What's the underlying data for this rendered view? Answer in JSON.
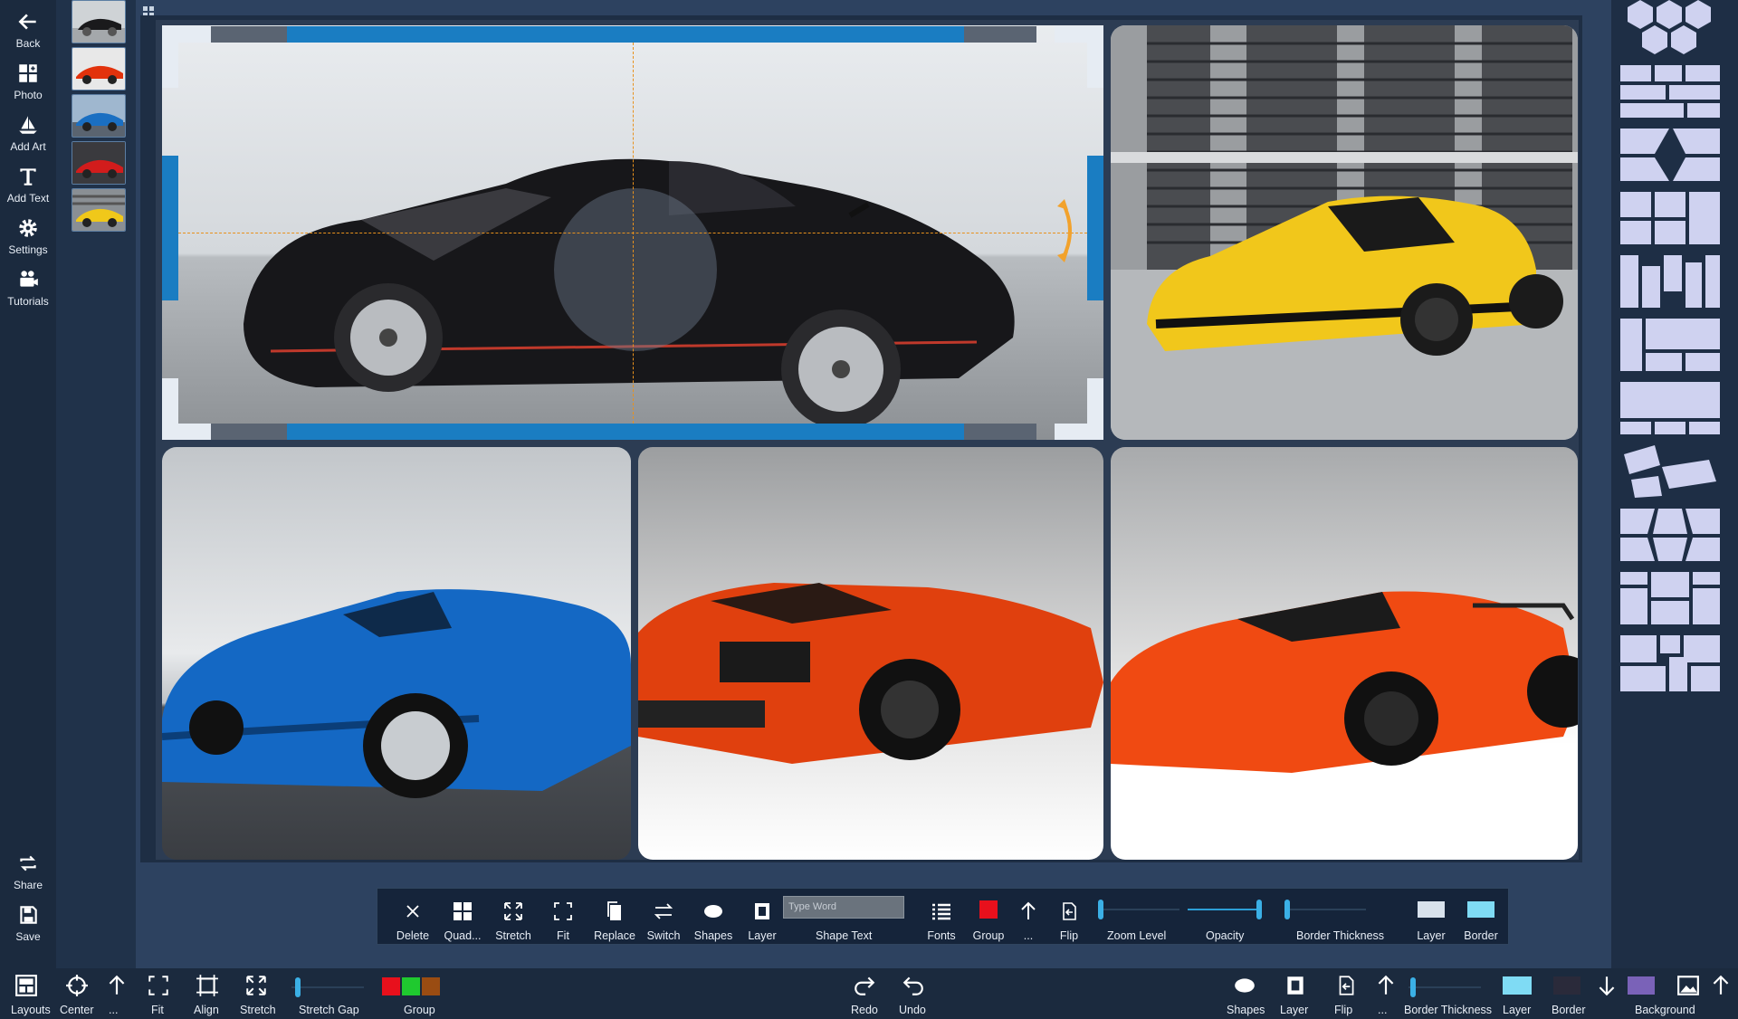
{
  "left_toolbar": {
    "items": [
      {
        "label": "Back",
        "icon": "arrow-left-icon"
      },
      {
        "label": "Photo",
        "icon": "photo-grid-icon"
      },
      {
        "label": "Add Art",
        "icon": "sailboat-icon"
      },
      {
        "label": "Add Text",
        "icon": "text-t-icon"
      },
      {
        "label": "Settings",
        "icon": "gear-icon"
      },
      {
        "label": "Tutorials",
        "icon": "camera-icon"
      }
    ],
    "bottom_items": [
      {
        "label": "Share",
        "icon": "share-icon"
      },
      {
        "label": "Save",
        "icon": "save-icon"
      }
    ]
  },
  "thumbnails": [
    "black-ferrari",
    "red-lamborghini",
    "blue-ferrari",
    "red-ferrari",
    "yellow-lamborghini"
  ],
  "collage": {
    "cells": [
      {
        "photo": "black Ferrari roadster",
        "selected": true
      },
      {
        "photo": "yellow Lamborghini"
      },
      {
        "photo": "blue Ferrari spider"
      },
      {
        "photo": "orange Lamborghini coupe"
      },
      {
        "photo": "orange Lamborghini roadster"
      }
    ],
    "selection_accent": "#1a7dc2",
    "guide_color": "#e8911c"
  },
  "float_toolbar": {
    "delete": "Delete",
    "quad": "Quad...",
    "stretch": "Stretch",
    "fit": "Fit",
    "replace": "Replace",
    "switch": "Switch",
    "shapes": "Shapes",
    "layer": "Layer",
    "shape_text_placeholder": "Type Word",
    "shape_text": "Shape Text",
    "fonts": "Fonts",
    "group": "Group",
    "more": "...",
    "flip": "Flip",
    "zoom_level": "Zoom Level",
    "opacity": "Opacity",
    "border_thickness": "Border Thickness",
    "layer2": "Layer",
    "border": "Border",
    "group_color": "#e8101c",
    "layer_color": "#d8e2ec",
    "border_color": "#7fdbf4"
  },
  "bottom_bar": {
    "layouts": "Layouts",
    "center": "Center",
    "more1": "...",
    "fit": "Fit",
    "align": "Align",
    "stretch": "Stretch",
    "stretch_gap": "Stretch Gap",
    "group": "Group",
    "group_colors": [
      "#e8101c",
      "#1fc92f",
      "#9a4c12"
    ],
    "redo": "Redo",
    "undo": "Undo",
    "shapes": "Shapes",
    "layer": "Layer",
    "flip": "Flip",
    "more2": "...",
    "border_thickness": "Border Thickness",
    "layer2": "Layer",
    "border": "Border",
    "background": "Background",
    "layer_color": "#7fdbf4",
    "border_color": "#2a2a3a",
    "background_color": "#7a62b8"
  }
}
